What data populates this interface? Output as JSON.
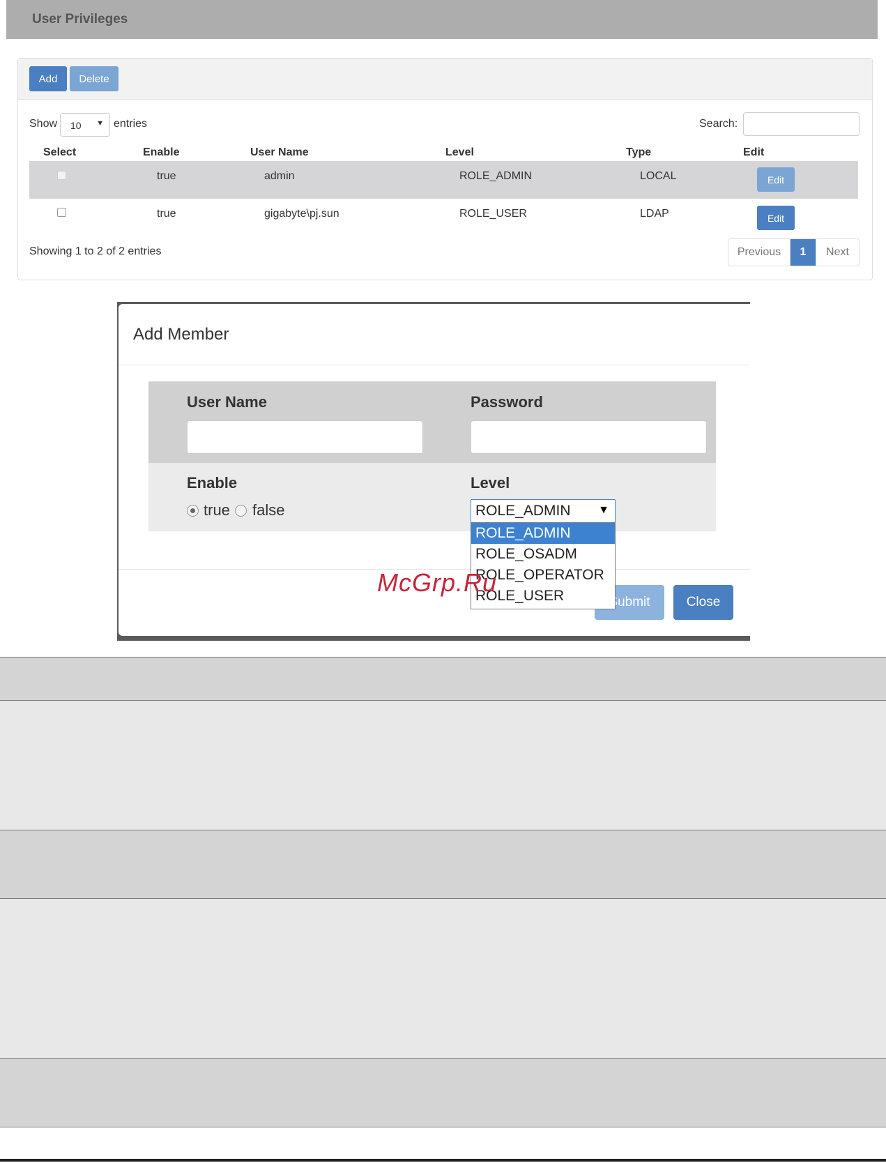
{
  "header": {
    "title": "User Privileges"
  },
  "toolbar": {
    "add_label": "Add",
    "delete_label": "Delete"
  },
  "table_controls": {
    "show_label": "Show",
    "entries_value": "10",
    "entries_label": "entries",
    "search_label": "Search:"
  },
  "table": {
    "columns": [
      "Select",
      "Enable",
      "User Name",
      "Level",
      "Type",
      "Edit"
    ],
    "rows": [
      {
        "enable": "true",
        "user_name": "admin",
        "level": "ROLE_ADMIN",
        "type": "LOCAL",
        "edit_label": "Edit"
      },
      {
        "enable": "true",
        "user_name": "gigabyte\\pj.sun",
        "level": "ROLE_USER",
        "type": "LDAP",
        "edit_label": "Edit"
      }
    ]
  },
  "footer": {
    "info": "Showing 1 to 2 of 2 entries",
    "pagination": {
      "previous": "Previous",
      "current": "1",
      "next": "Next"
    }
  },
  "modal": {
    "title": "Add Member",
    "username_label": "User Name",
    "password_label": "Password",
    "enable_label": "Enable",
    "enable_true": "true",
    "enable_false": "false",
    "level_label": "Level",
    "level_value": "ROLE_ADMIN",
    "level_options": [
      "ROLE_ADMIN",
      "ROLE_OSADM",
      "ROLE_OPERATOR",
      "ROLE_USER"
    ],
    "submit_label": "Submit",
    "close_label": "Close"
  },
  "watermark": "McGrp.Ru",
  "colors": {
    "primary": "#4a7fc1",
    "primary_light": "#7ba5d3",
    "header_bg": "#adadad",
    "watermark": "#c7253a"
  }
}
